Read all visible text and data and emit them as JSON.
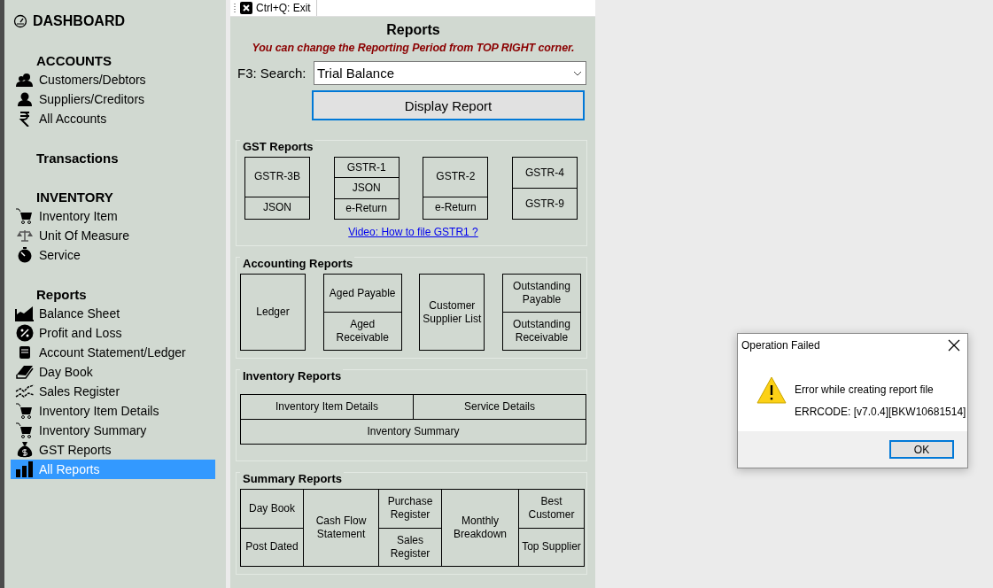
{
  "sidebar": {
    "sections": [
      {
        "heading": "DASHBOARD",
        "kind": "link"
      },
      {
        "heading": "ACCOUNTS",
        "kind": "section",
        "items": [
          {
            "label": "Customers/Debtors",
            "selected": false
          },
          {
            "label": "Suppliers/Creditors",
            "selected": false
          },
          {
            "label": "All Accounts",
            "selected": false
          }
        ]
      },
      {
        "heading": "Transactions",
        "kind": "section"
      },
      {
        "heading": "INVENTORY",
        "kind": "section",
        "items": [
          {
            "label": "Inventory Item",
            "selected": false
          },
          {
            "label": "Unit Of Measure",
            "selected": false
          },
          {
            "label": "Service",
            "selected": false
          }
        ]
      },
      {
        "heading": "Reports",
        "kind": "section",
        "items": [
          {
            "label": "Balance Sheet",
            "selected": false
          },
          {
            "label": "Profit and Loss",
            "selected": false
          },
          {
            "label": "Account Statement/Ledger",
            "selected": false
          },
          {
            "label": "Day Book",
            "selected": false
          },
          {
            "label": "Sales Register",
            "selected": false
          },
          {
            "label": "Inventory Item Details",
            "selected": false
          },
          {
            "label": "Inventory Summary",
            "selected": false
          },
          {
            "label": "GST Reports",
            "selected": false
          },
          {
            "label": "All Reports",
            "selected": true
          }
        ]
      }
    ]
  },
  "toolbar": {
    "exit_button": "Ctrl+Q: Exit"
  },
  "reports": {
    "title": "Reports",
    "notice": "You can change the Reporting Period from TOP RIGHT corner.",
    "search": {
      "label": "F3: Search:",
      "value": "Trial Balance"
    },
    "display_button": "Display Report",
    "groups": [
      {
        "title": "GST Reports",
        "kind": "tiles",
        "columns": [
          [
            "GSTR-3B",
            "JSON"
          ],
          [
            "GSTR-1",
            "JSON",
            "e-Return"
          ],
          [
            "GSTR-2",
            "e-Return"
          ],
          [
            "GSTR-4",
            "GSTR-9"
          ]
        ],
        "link": "Video: How to file GSTR1 ?"
      },
      {
        "title": "Accounting Reports",
        "kind": "tiles",
        "columns": [
          [
            "Ledger"
          ],
          [
            "Aged Payable",
            "Aged Receivable"
          ],
          [
            "Customer Supplier List"
          ],
          [
            "Outstanding Payable",
            "Outstanding Receivable"
          ]
        ]
      },
      {
        "title": "Inventory Reports",
        "kind": "rows",
        "rows": [
          [
            "Inventory Item Details",
            "Service Details"
          ],
          [
            "Inventory Summary"
          ]
        ]
      },
      {
        "title": "Summary Reports",
        "kind": "joined",
        "columns": [
          [
            "Day Book",
            "Post Dated"
          ],
          [
            "Cash Flow Statement"
          ],
          [
            "Purchase Register",
            "Sales Register"
          ],
          [
            "Monthly Breakdown"
          ],
          [
            "Best Customer",
            "Top Supplier"
          ]
        ]
      }
    ]
  },
  "dialog": {
    "title": "Operation Failed",
    "message": "Error while creating report file",
    "code": "ERRCODE: [v7.0.4][BKW10681514]",
    "ok_button": "OK"
  }
}
